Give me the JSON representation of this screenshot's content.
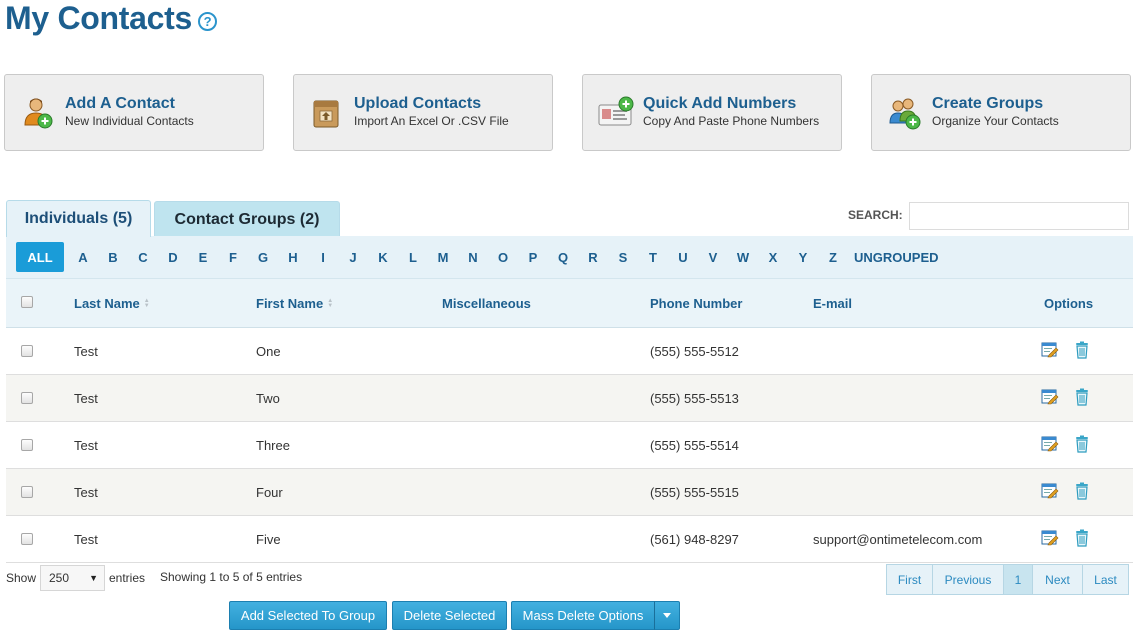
{
  "page": {
    "title": "My Contacts",
    "help_glyph": "?"
  },
  "actions": [
    {
      "title": "Add A Contact",
      "subtitle": "New Individual Contacts",
      "icon": "add-contact-icon"
    },
    {
      "title": "Upload Contacts",
      "subtitle": "Import An Excel Or .CSV File",
      "icon": "upload-box-icon"
    },
    {
      "title": "Quick Add Numbers",
      "subtitle": "Copy And Paste Phone Numbers",
      "icon": "quick-add-card-icon"
    },
    {
      "title": "Create Groups",
      "subtitle": "Organize Your Contacts",
      "icon": "create-group-icon"
    }
  ],
  "tabs": {
    "individuals": "Individuals (5)",
    "groups": "Contact Groups (2)"
  },
  "search": {
    "label": "SEARCH:",
    "value": ""
  },
  "alphabet": {
    "all": "ALL",
    "letters": [
      "A",
      "B",
      "C",
      "D",
      "E",
      "F",
      "G",
      "H",
      "I",
      "J",
      "K",
      "L",
      "M",
      "N",
      "O",
      "P",
      "Q",
      "R",
      "S",
      "T",
      "U",
      "V",
      "W",
      "X",
      "Y",
      "Z"
    ],
    "ungrouped": "UNGROUPED"
  },
  "table": {
    "headers": {
      "last_name": "Last Name",
      "first_name": "First Name",
      "misc": "Miscellaneous",
      "phone": "Phone Number",
      "email": "E-mail",
      "options": "Options"
    },
    "rows": [
      {
        "last": "Test",
        "first": "One",
        "misc": "",
        "phone": "(555) 555-5512",
        "email": ""
      },
      {
        "last": "Test",
        "first": "Two",
        "misc": "",
        "phone": "(555) 555-5513",
        "email": ""
      },
      {
        "last": "Test",
        "first": "Three",
        "misc": "",
        "phone": "(555) 555-5514",
        "email": ""
      },
      {
        "last": "Test",
        "first": "Four",
        "misc": "",
        "phone": "(555) 555-5515",
        "email": ""
      },
      {
        "last": "Test",
        "first": "Five",
        "misc": "",
        "phone": "(561) 948-8297",
        "email": "support@ontimetelecom.com"
      }
    ]
  },
  "footer": {
    "show": "Show",
    "page_size": "250",
    "entries": "entries",
    "info": "Showing 1 to 5 of 5 entries",
    "pager": {
      "first": "First",
      "previous": "Previous",
      "current": "1",
      "next": "Next",
      "last": "Last"
    },
    "buttons": {
      "add_to_group": "Add Selected To Group",
      "delete_selected": "Delete Selected",
      "mass_delete": "Mass Delete Options"
    }
  },
  "colors": {
    "title": "#1d5f8f",
    "accent": "#1a9cd8",
    "tab_bg": "#e6f2f8"
  }
}
